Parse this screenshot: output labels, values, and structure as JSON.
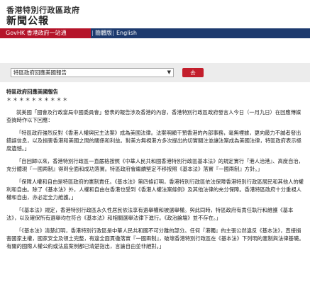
{
  "header": {
    "site_name": "香港特別行政區政府",
    "site_title": "新聞公報"
  },
  "nav": {
    "gov_link": "GovHK 香港政府一站通",
    "simplified": "簡體版",
    "english": "English"
  },
  "toolbar": {
    "select_value": "特區政府回應美國報告",
    "go_label": "去"
  },
  "article": {
    "heading": "特區政府回應美國報告",
    "stars": "＊＊＊＊＊＊＊＊＊＊",
    "paragraphs": [
      "就美國「國會及行政當局中國委員會」發表的報告涉及香港的內容，香港特別行政區政府發言人今日（一月九日）在回應傳媒查詢時作以下回應：",
      "「特區政府強烈反對《香港人權與民主法案》成為美國法律。法案明顯干預香港的內部事務，毫無裡據，更向最力不誠者發出錯誤信息，以及損害香港和美國之間的關係和利益。對美方無視港方多次提出的切實關注並讓法案成為美國法律，特區政府表示極度遺憾。」",
      "「自回歸以來，香港特別行政區一直嚴格按照《中華人民共和國香港特別行政區基本法》的規定實行『港人治港』、高度自治，充分體現『一國兩制』得到全面和成功落實。特區政府會繼續堅定不移按照《基本法》落實『一國兩制』方針。」",
      "「保障人權和自由是特區政府的憲制責任。《基本法》第四條訂明，香港特別行政區依法保障香港特別行政區居民和其他人的權利和自由。除了《基本法》外，人權和自由在香港也受到《香港人權法案條例》及其他法律的充分保障。香港特區政府十分重視人權和自由，亦必定全力維護。」",
      "「《基本法》規定，香港特別行政區永久性居民依法享有選舉權和被選舉權。與此同時，特區政府有責任執行和維護《基本法》，以及確保所有選舉均在符合《基本法》和相關選舉法律下進行。《政治論壇》並不存在。」",
      "「《基本法》清楚訂明，香港特別行政區是中華人民共和國不可分離的部分。任何『港獨』的主張公然違反《基本法》，直接損害國家主權，國家安全及領土完整，有違全面貫徹落實『一國兩制』，破壞香港特別行政區在《基本法》下列明的憲制與法律基礎。有關的國際人權公約或法庭案例都已清楚指出，言論自由並非絕對。」"
    ]
  }
}
